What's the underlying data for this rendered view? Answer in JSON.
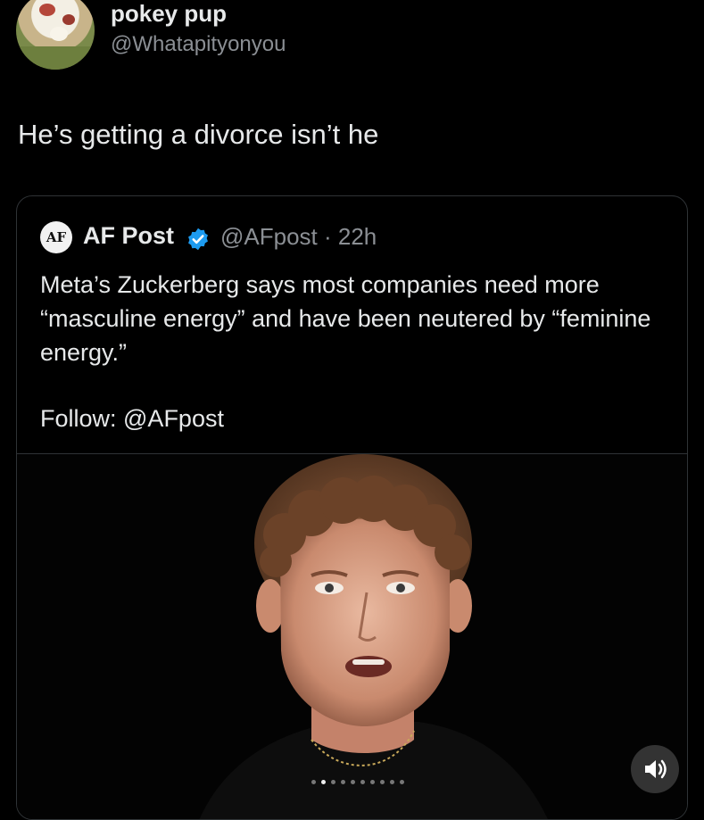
{
  "tweet": {
    "display_name": "pokey pup",
    "handle": "@Whatapityonyou",
    "text": "He’s getting a divorce isn’t he",
    "avatar_icon": "dog-avatar"
  },
  "quoted": {
    "avatar_initials": "AF",
    "name": "AF Post",
    "verified_icon": "verified-badge-icon",
    "handle_time": "@AFpost · 22h",
    "text": "Meta’s Zuckerberg says most companies need more “masculine energy” and have been neutered by “feminine energy.”",
    "follow": "Follow: @AFpost",
    "media": {
      "sound_icon": "speaker-icon",
      "carousel_pages": 10,
      "active_page": 2
    }
  },
  "colors": {
    "background": "#000000",
    "text": "#e7e9ea",
    "secondary": "#8b8f94",
    "border": "#2f3336",
    "verified": "#1d9bf0"
  }
}
